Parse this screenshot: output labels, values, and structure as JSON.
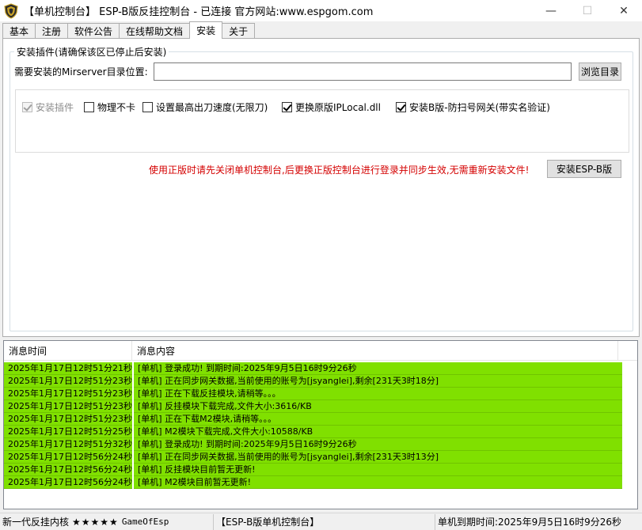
{
  "window": {
    "title": "【单机控制台】 ESP-B版反挂控制台 - 已连接    官方网站:www.espgom.com",
    "minimize_glyph": "—",
    "maximize_glyph": "☐",
    "close_glyph": "✕"
  },
  "tabs": [
    {
      "label": "基本",
      "active": false
    },
    {
      "label": "注册",
      "active": false
    },
    {
      "label": "软件公告",
      "active": false
    },
    {
      "label": "在线帮助文档",
      "active": false
    },
    {
      "label": "安装",
      "active": true
    },
    {
      "label": "关于",
      "active": false
    }
  ],
  "install": {
    "group_title": "安装插件(请确保该区已停止后安装)",
    "dir_label": "需要安装的Mirserver目录位置:",
    "dir_value": "",
    "browse_label": "浏览目录",
    "options": [
      {
        "label": "安装插件",
        "checked": true,
        "disabled": true
      },
      {
        "label": "物理不卡",
        "checked": false,
        "disabled": false
      },
      {
        "label": "设置最高出刀速度(无限刀)",
        "checked": false,
        "disabled": false
      },
      {
        "label": "更换原版IPLocal.dll",
        "checked": true,
        "disabled": false
      },
      {
        "label": "安装B版-防扫号网关(带实名验证)",
        "checked": true,
        "disabled": false
      }
    ],
    "notice": "使用正版时请先关闭单机控制台,后更换正版控制台进行登录并同步生效,无需重新安装文件!",
    "install_button": "安装ESP-B版"
  },
  "log": {
    "col_time": "消息时间",
    "col_msg": "消息内容",
    "highlight_color": "#80e000",
    "rows": [
      {
        "time": "2025年1月17日12时51分21秒",
        "msg": "[单机] 登录成功! 到期时间:2025年9月5日16时9分26秒"
      },
      {
        "time": "2025年1月17日12时51分23秒",
        "msg": "[单机] 正在同步网关数据,当前使用的账号为[jsyanglei],剩余[231天3时18分]"
      },
      {
        "time": "2025年1月17日12时51分23秒",
        "msg": "[单机] 正在下载反挂模块,请稍等。。。"
      },
      {
        "time": "2025年1月17日12时51分23秒",
        "msg": "[单机] 反挂模块下载完成,文件大小:3616/KB"
      },
      {
        "time": "2025年1月17日12时51分23秒",
        "msg": "[单机] 正在下载M2模块,请稍等。。。"
      },
      {
        "time": "2025年1月17日12时51分25秒",
        "msg": "[单机] M2模块下载完成,文件大小:10588/KB"
      },
      {
        "time": "2025年1月17日12时51分32秒",
        "msg": "[单机] 登录成功! 到期时间:2025年9月5日16时9分26秒"
      },
      {
        "time": "2025年1月17日12时56分24秒",
        "msg": "[单机] 正在同步网关数据,当前使用的账号为[jsyanglei],剩余[231天3时13分]"
      },
      {
        "time": "2025年1月17日12时56分24秒",
        "msg": "[单机] 反挂模块目前暂无更新!"
      },
      {
        "time": "2025年1月17日12时56分24秒",
        "msg": "[单机] M2模块目前暂无更新!"
      }
    ]
  },
  "statusbar": {
    "left_text": "新一代反挂内核",
    "stars": "★★★★★",
    "brand": "GameOfEsp",
    "middle_text": "【ESP-B版单机控制台】",
    "right_text": "单机到期时间:2025年9月5日16时9分26秒"
  }
}
